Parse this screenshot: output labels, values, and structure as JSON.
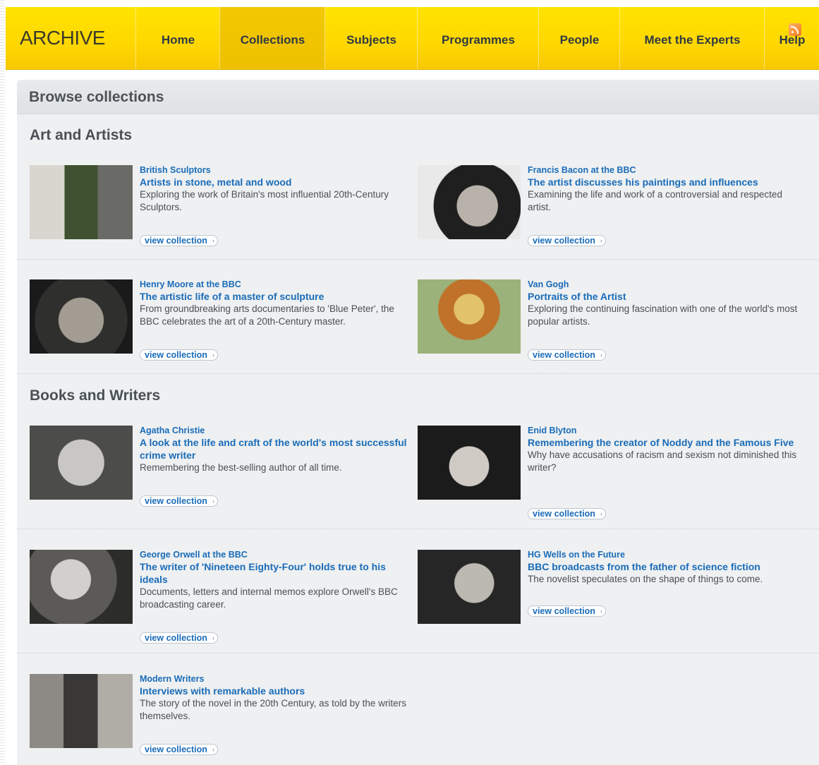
{
  "nav": {
    "logo": "ARCHIVE",
    "items": [
      {
        "label": "Home"
      },
      {
        "label": "Collections"
      },
      {
        "label": "Subjects"
      },
      {
        "label": "Programmes"
      },
      {
        "label": "People"
      },
      {
        "label": "Meet the Experts"
      },
      {
        "label": "Help"
      }
    ],
    "active": "Collections"
  },
  "page": {
    "title": "Browse collections"
  },
  "sections": [
    {
      "title": "Art and Artists",
      "cards": [
        {
          "name": "British Sculptors",
          "tagline": "Artists in stone, metal and wood",
          "description": "Exploring the work of Britain's most influential 20th-Century Sculptors.",
          "button": "view collection"
        },
        {
          "name": "Francis Bacon at the BBC",
          "tagline": "The artist discusses his paintings and influences",
          "description": "Examining the life and work of a controversial and respected artist.",
          "button": "view collection"
        },
        {
          "name": "Henry Moore at the BBC",
          "tagline": "The artistic life of a master of sculpture",
          "description": "From groundbreaking arts documentaries to 'Blue Peter', the BBC celebrates the art of a 20th-Century master.",
          "button": "view collection"
        },
        {
          "name": "Van Gogh",
          "tagline": "Portraits of the Artist",
          "description": "Exploring the continuing fascination with one of the world's most popular artists.",
          "button": "view collection"
        }
      ]
    },
    {
      "title": "Books and Writers",
      "cards": [
        {
          "name": "Agatha Christie",
          "tagline": "A look at the life and craft of the world's most successful crime writer",
          "description": "Remembering the best-selling author of all time.",
          "button": "view collection"
        },
        {
          "name": "Enid Blyton",
          "tagline": "Remembering the creator of Noddy and the Famous Five",
          "description": "Why have accusations of racism and sexism not diminished this writer?",
          "button": "view collection"
        },
        {
          "name": "George Orwell at the BBC",
          "tagline": "The writer of 'Nineteen Eighty-Four' holds true to his ideals",
          "description": "Documents, letters and internal memos explore Orwell's BBC broadcasting career.",
          "button": "view collection"
        },
        {
          "name": "HG Wells on the Future",
          "tagline": "BBC broadcasts from the father of science fiction",
          "description": "The novelist speculates on the shape of things to come.",
          "button": "view collection"
        },
        {
          "name": "Modern Writers",
          "tagline": "Interviews with remarkable authors",
          "description": "The story of the novel in the 20th Century, as told by the writers themselves.",
          "button": "view collection"
        }
      ]
    }
  ],
  "colors": {
    "nav_yellow": "#ffd700",
    "link_blue": "#1a6cb8",
    "panel_bg": "#eef0f1"
  }
}
